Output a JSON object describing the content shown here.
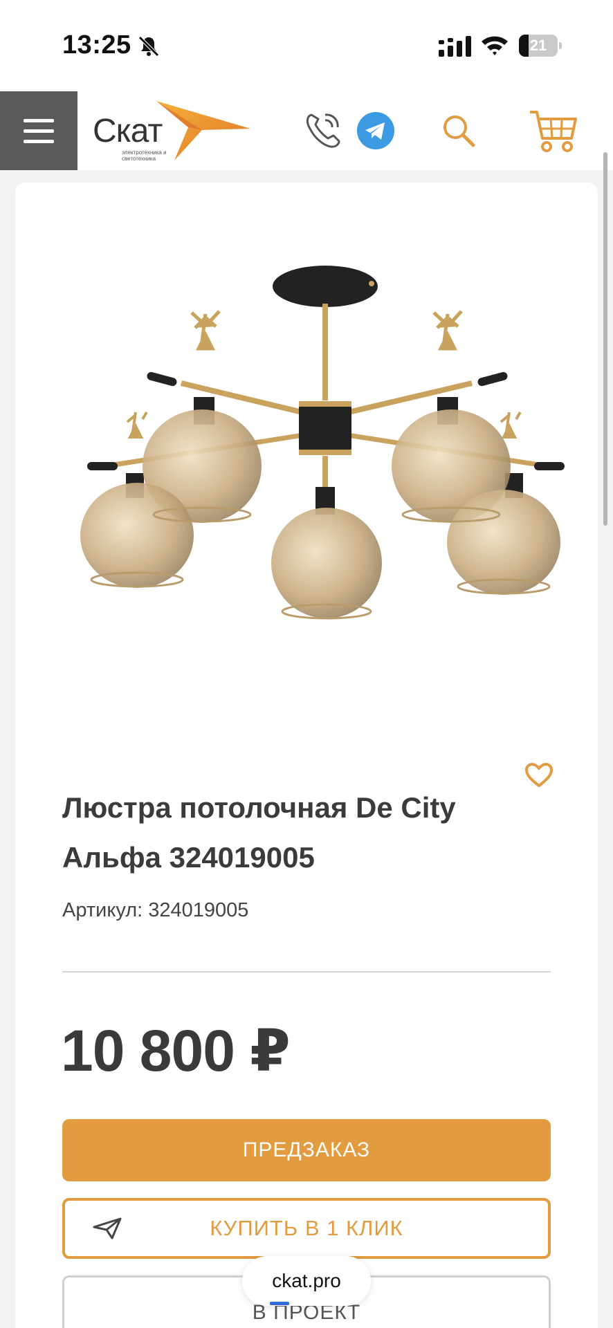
{
  "status_bar": {
    "time": "13:25",
    "battery": "21",
    "icons": [
      "bell-muted-icon",
      "signal-icon",
      "wifi-icon",
      "battery-icon"
    ]
  },
  "header": {
    "logo": {
      "name": "Скат",
      "subtitle": "электротехника и светотехника"
    },
    "icons": [
      "menu-icon",
      "phone-icon",
      "telegram-icon",
      "search-icon",
      "cart-icon"
    ]
  },
  "product": {
    "title": "Люстра потолочная De City Альфа 324019005",
    "sku": "Артикул: 324019005",
    "price": "10 800 ₽",
    "buttons": {
      "preorder": "ПРЕДЗАКАЗ",
      "one_click": "КУПИТЬ В 1 КЛИК",
      "project": "В ПРОЕКТ"
    }
  },
  "browser": {
    "url": "ckat.pro"
  },
  "colors": {
    "accent": "#e29b3f",
    "menu_bg": "#5a5a5a",
    "telegram": "#3b9ae1"
  }
}
